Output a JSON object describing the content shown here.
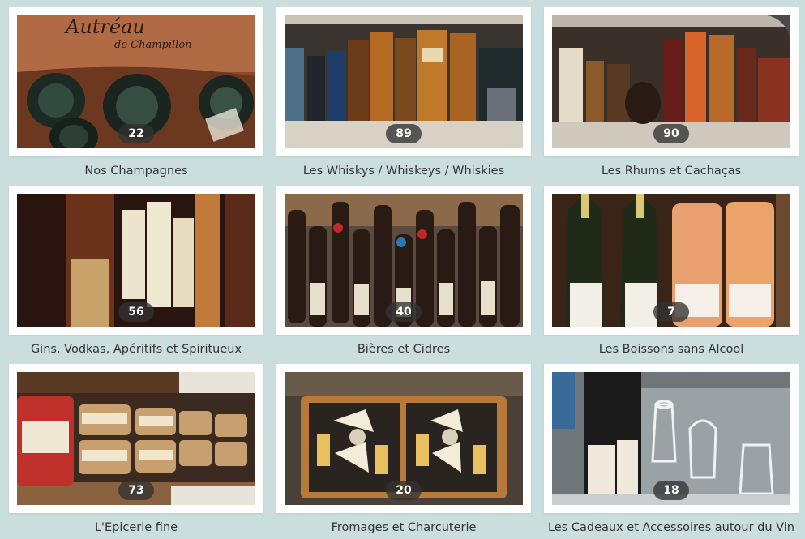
{
  "categories": [
    {
      "label": "Nos Champagnes",
      "count": "22"
    },
    {
      "label": "Les Whiskys / Whiskeys / Whiskies",
      "count": "89"
    },
    {
      "label": "Les Rhums et Cachaças",
      "count": "90"
    },
    {
      "label": "Gins, Vodkas, Apéritifs et Spiritueux",
      "count": "56"
    },
    {
      "label": "Bières et Cidres",
      "count": "40"
    },
    {
      "label": "Les Boissons sans Alcool",
      "count": "7"
    },
    {
      "label": "L'Epicerie fine",
      "count": "73"
    },
    {
      "label": "Fromages et Charcuterie",
      "count": "20"
    },
    {
      "label": "Les Cadeaux et Accessoires autour du Vin",
      "count": "18"
    }
  ],
  "photo_text": {
    "champagne_brand": "Autréau",
    "champagne_sub": "de Champillon"
  }
}
